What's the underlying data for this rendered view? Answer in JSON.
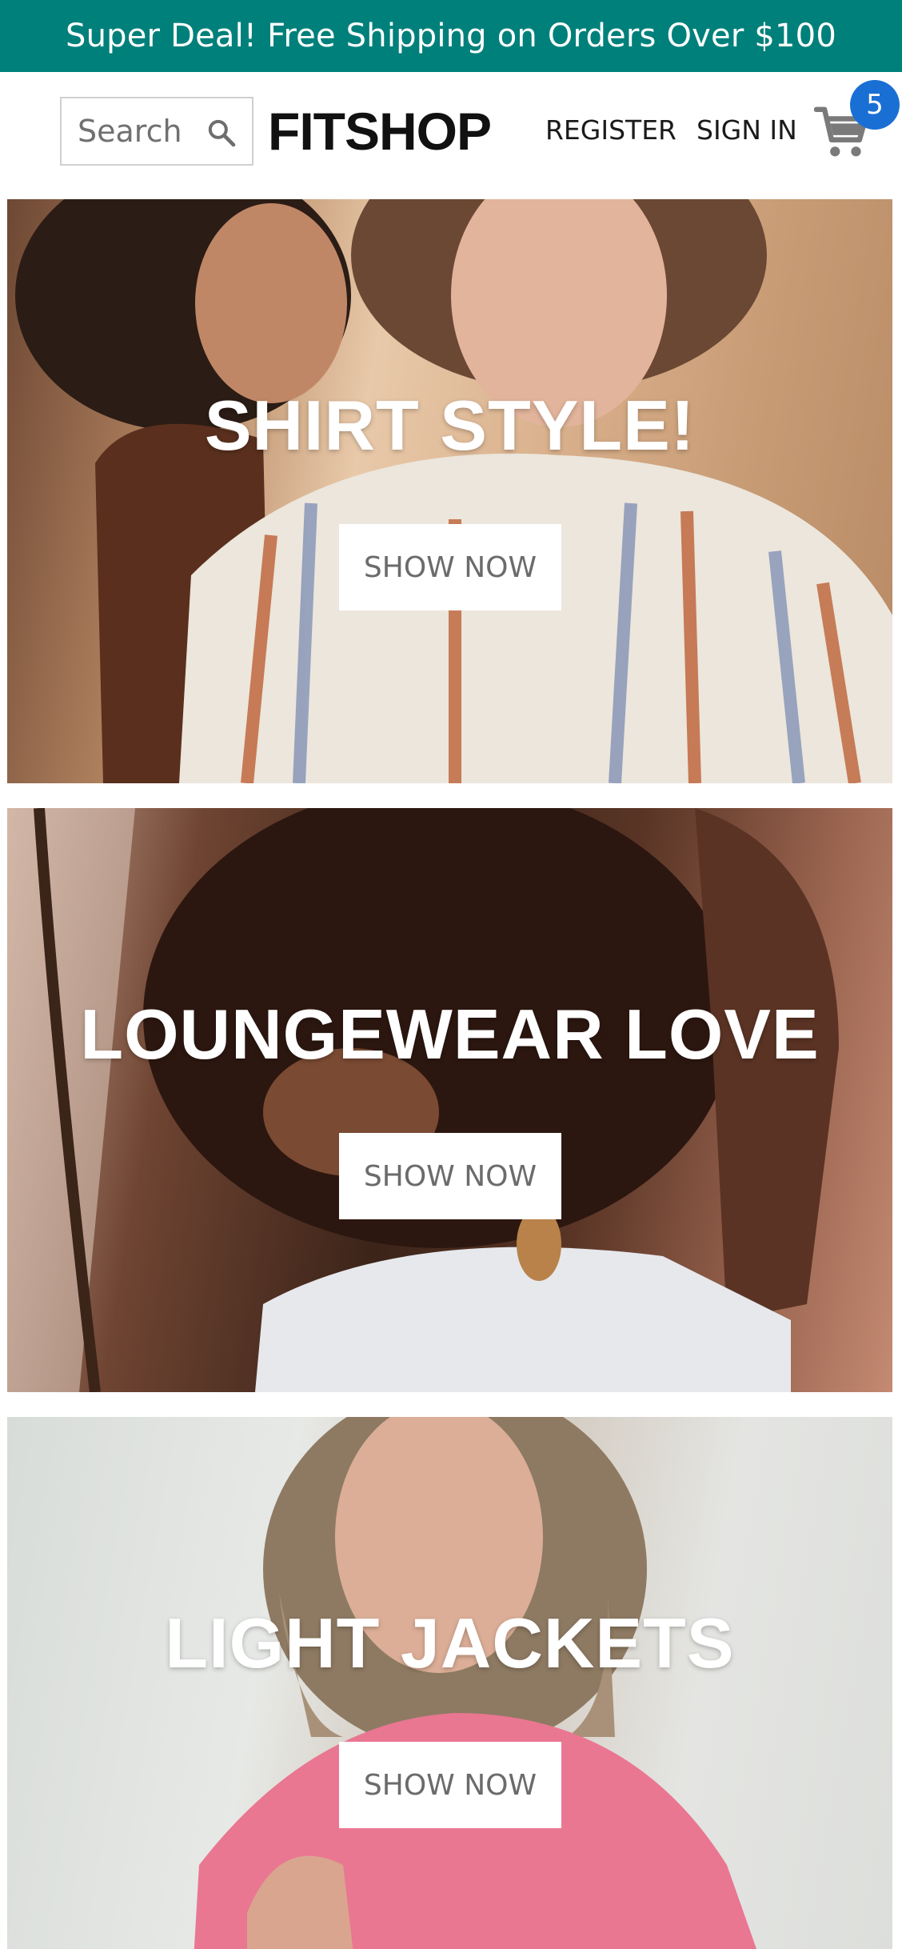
{
  "announcement": {
    "text": "Super Deal! Free Shipping on Orders Over $100",
    "background": "#00807b"
  },
  "header": {
    "search": {
      "placeholder": "Search",
      "icon": "search-icon"
    },
    "logo": "FITSHOP",
    "nav": {
      "register": "REGISTER",
      "sign_in": "SIGN IN"
    },
    "cart": {
      "icon": "cart-icon",
      "count": "5",
      "badge_color": "#1a6fd4"
    }
  },
  "banners": [
    {
      "title": "SHIRT STYLE!",
      "button": "SHOW NOW"
    },
    {
      "title": "LOUNGEWEAR LOVE",
      "button": "SHOW NOW"
    },
    {
      "title": "LIGHT JACKETS",
      "button": "SHOW NOW"
    }
  ]
}
